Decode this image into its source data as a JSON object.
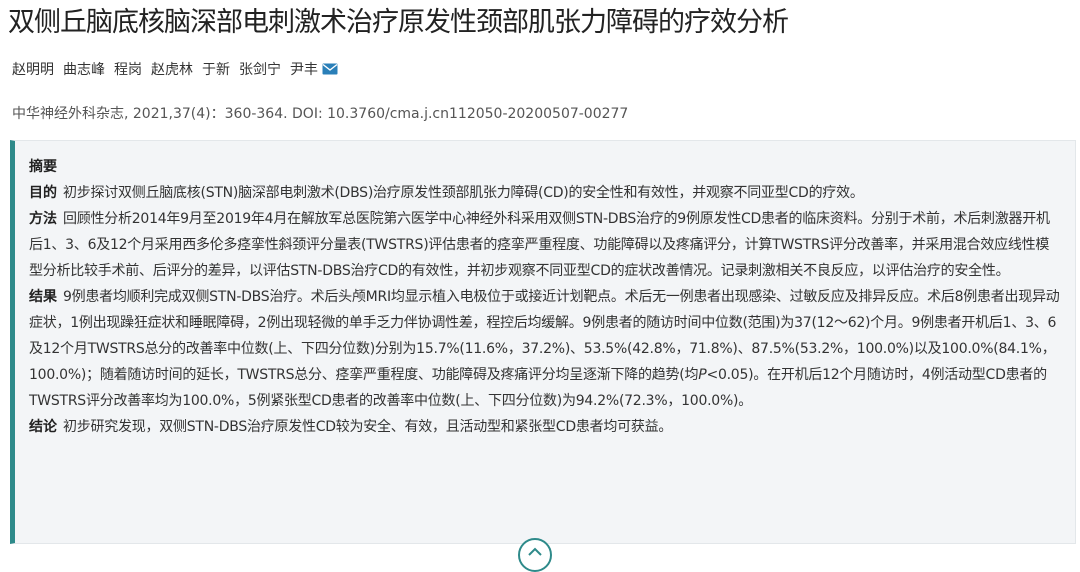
{
  "article": {
    "title": "双侧丘脑底核脑深部电刺激术治疗原发性颈部肌张力障碍的疗效分析",
    "authors": [
      "赵明明",
      "曲志峰",
      "程岗",
      "赵虎林",
      "于新",
      "张剑宁",
      "尹丰"
    ],
    "citation": "中华神经外科杂志, 2021,37(4)：360-364. DOI: 10.3760/cma.j.cn112050-20200507-00277"
  },
  "abstract": {
    "heading": "摘要",
    "sections": [
      {
        "label": "目的",
        "text": "初步探讨双侧丘脑底核(STN)脑深部电刺激术(DBS)治疗原发性颈部肌张力障碍(CD)的安全性和有效性，并观察不同亚型CD的疗效。"
      },
      {
        "label": "方法",
        "text": "回顾性分析2014年9月至2019年4月在解放军总医院第六医学中心神经外科采用双侧STN-DBS治疗的9例原发性CD患者的临床资料。分别于术前，术后刺激器开机后1、3、6及12个月采用西多伦多痉挛性斜颈评分量表(TWSTRS)评估患者的痉挛严重程度、功能障碍以及疼痛评分，计算TWSTRS评分改善率，并采用混合效应线性模型分析比较手术前、后评分的差异，以评估STN-DBS治疗CD的有效性，并初步观察不同亚型CD的症状改善情况。记录刺激相关不良反应，以评估治疗的安全性。"
      },
      {
        "label": "结果",
        "text_before": "9例患者均顺利完成双侧STN-DBS治疗。术后头颅MRI均显示植入电极位于或接近计划靶点。术后无一例患者出现感染、过敏反应及排异反应。术后8例患者出现异动症状，1例出现躁狂症状和睡眠障碍，2例出现轻微的单手乏力伴协调性差，程控后均缓解。9例患者的随访时间中位数(范围)为37(12～62)个月。9例患者开机后1、3、6及12个月TWSTRS总分的改善率中位数(上、下四分位数)分别为15.7%(11.6%，37.2%)、53.5%(42.8%，71.8%)、87.5%(53.2%，100.0%)以及100.0%(84.1%，100.0%)；随着随访时间的延长，TWSTRS总分、痉挛严重程度、功能障碍及疼痛评分均呈逐渐下降的趋势(均",
        "p_symbol": "P",
        "text_after": "<0.05)。在开机后12个月随访时，4例活动型CD患者的TWSTRS评分改善率均为100.0%，5例紧张型CD患者的改善率中位数(上、下四分位数)为94.2%(72.3%，100.0%)。"
      },
      {
        "label": "结论",
        "text": "初步研究发现，双侧STN-DBS治疗原发性CD较为安全、有效，且活动型和紧张型CD患者均可获益。"
      }
    ]
  },
  "icons": {
    "mail": "envelope-icon",
    "expand": "chevron-up-icon"
  },
  "colors": {
    "accent": "#2e8a8a",
    "mail": "#2a7fb8",
    "box_bg": "#f3f5f7"
  }
}
